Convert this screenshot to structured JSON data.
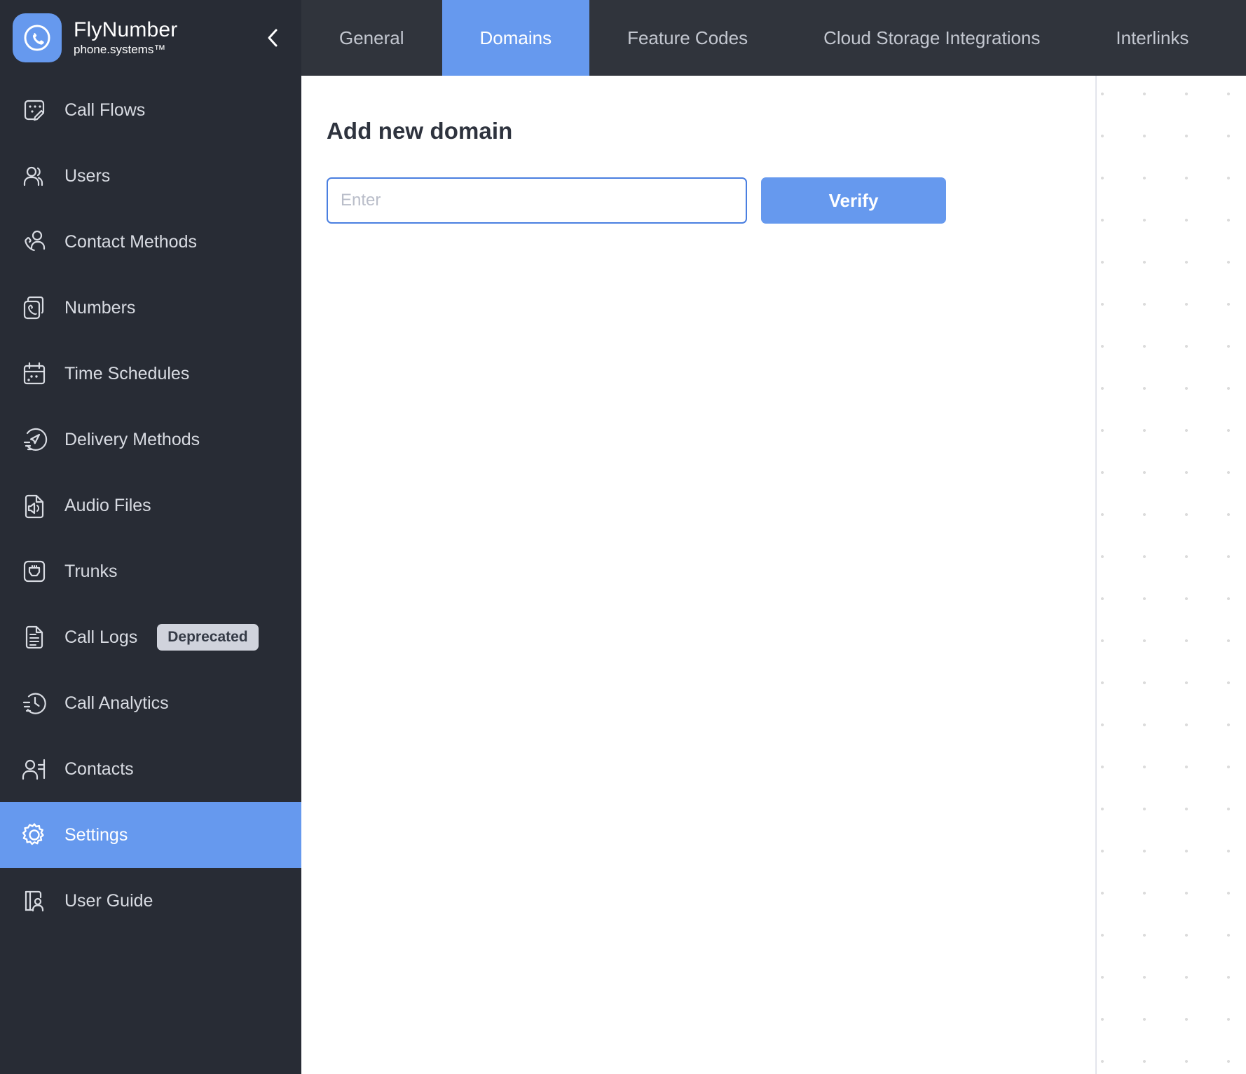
{
  "brand": {
    "title": "FlyNumber",
    "subtitle": "phone.systems™",
    "logo_icon": "phone-circle-icon",
    "collapse_icon": "chevron-left-icon",
    "accent_color": "#6699ee",
    "sidebar_bg": "#282c35",
    "tabbar_bg": "#30343c"
  },
  "sidebar": {
    "items": [
      {
        "label": "Call Flows",
        "icon": "call-flows-icon",
        "active": false,
        "badge": null
      },
      {
        "label": "Users",
        "icon": "users-icon",
        "active": false,
        "badge": null
      },
      {
        "label": "Contact Methods",
        "icon": "contact-methods-icon",
        "active": false,
        "badge": null
      },
      {
        "label": "Numbers",
        "icon": "numbers-icon",
        "active": false,
        "badge": null
      },
      {
        "label": "Time Schedules",
        "icon": "calendar-icon",
        "active": false,
        "badge": null
      },
      {
        "label": "Delivery Methods",
        "icon": "delivery-methods-icon",
        "active": false,
        "badge": null
      },
      {
        "label": "Audio Files",
        "icon": "audio-file-icon",
        "active": false,
        "badge": null
      },
      {
        "label": "Trunks",
        "icon": "trunks-icon",
        "active": false,
        "badge": null
      },
      {
        "label": "Call Logs",
        "icon": "document-icon",
        "active": false,
        "badge": "Deprecated"
      },
      {
        "label": "Call Analytics",
        "icon": "clock-analytics-icon",
        "active": false,
        "badge": null
      },
      {
        "label": "Contacts",
        "icon": "contacts-icon",
        "active": false,
        "badge": null
      },
      {
        "label": "Settings",
        "icon": "gear-icon",
        "active": true,
        "badge": null
      },
      {
        "label": "User Guide",
        "icon": "user-guide-icon",
        "active": false,
        "badge": null
      }
    ]
  },
  "tabs": [
    {
      "label": "General",
      "active": false
    },
    {
      "label": "Domains",
      "active": true
    },
    {
      "label": "Feature Codes",
      "active": false
    },
    {
      "label": "Cloud Storage Integrations",
      "active": false
    },
    {
      "label": "Interlinks",
      "active": false
    }
  ],
  "main": {
    "title": "Add new domain",
    "domain_input": {
      "value": "",
      "placeholder": "Enter"
    },
    "verify_label": "Verify"
  }
}
